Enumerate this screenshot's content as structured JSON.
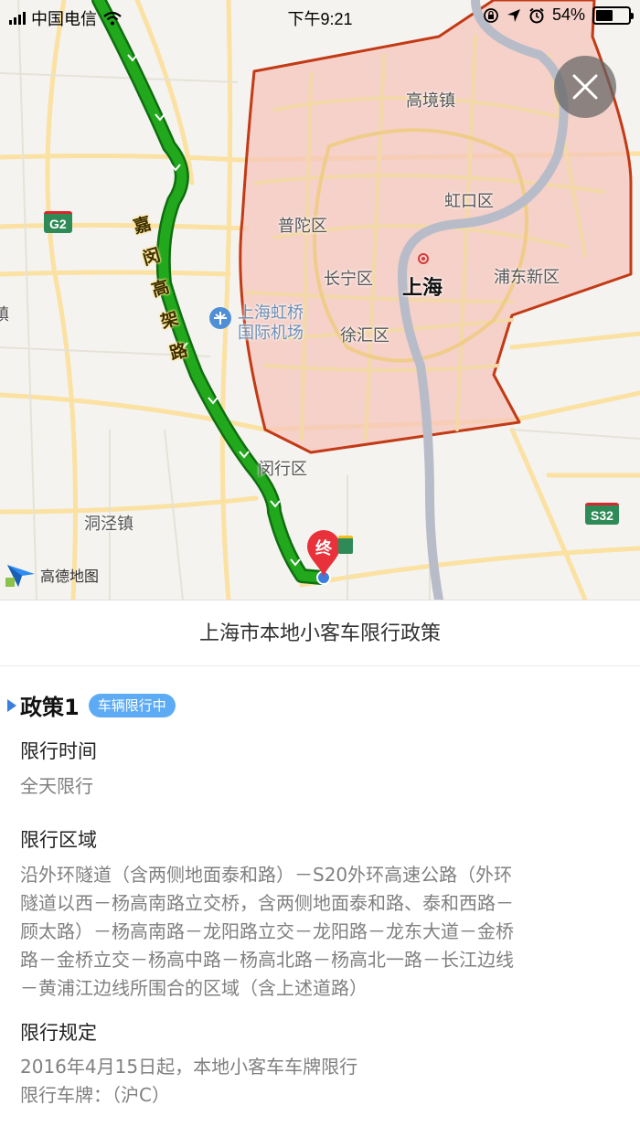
{
  "status_bar": {
    "carrier": "中国电信",
    "time": "下午9:21",
    "battery_text": "54%",
    "battery_level": 0.54,
    "icons": [
      "signal-icon",
      "wifi-icon",
      "lock-rotation-icon",
      "location-arrow-icon",
      "alarm-icon",
      "battery-icon"
    ]
  },
  "map": {
    "labels": {
      "gaojing": "高境镇",
      "hongkou": "虹口区",
      "putuo": "普陀区",
      "changning": "长宁区",
      "shanghai": "上海",
      "pudong": "浦东新区",
      "xuhui": "徐汇区",
      "hongqiao_1": "上海虹桥",
      "hongqiao_2": "国际机场",
      "minhang": "闵行区",
      "dongjing": "洞泾镇",
      "edge": "镇",
      "road_name": "嘉闵高架路"
    },
    "shields": {
      "g2": "G2",
      "s32": "S32"
    },
    "end_marker": "终",
    "logo_text": "高德地图",
    "colors": {
      "route": "#22a81c",
      "restricted_fill": "#f5c6bc",
      "restricted_border": "#c23a16"
    }
  },
  "panel": {
    "title": "上海市本地小客车限行政策",
    "policy": {
      "name": "政策1",
      "badge": "车辆限行中",
      "time_title": "限行时间",
      "time_value": "全天限行",
      "area_title": "限行区域",
      "area_lines": [
        "沿外环隧道（含两侧地面泰和路）－S20外环高速公路（外环",
        "隧道以西－杨高南路立交桥，含两侧地面泰和路、泰和西路－",
        "顾太路）－杨高南路－龙阳路立交－龙阳路－龙东大道－金桥",
        "路－金桥立交－杨高中路－杨高北路－杨高北一路－长江边线",
        "－黄浦江边线所围合的区域（含上述道路）"
      ],
      "rule_title": "限行规定",
      "rule_lines": [
        "2016年4月15日起，本地小客车车牌限行",
        "限行车牌：（沪C）"
      ]
    }
  }
}
